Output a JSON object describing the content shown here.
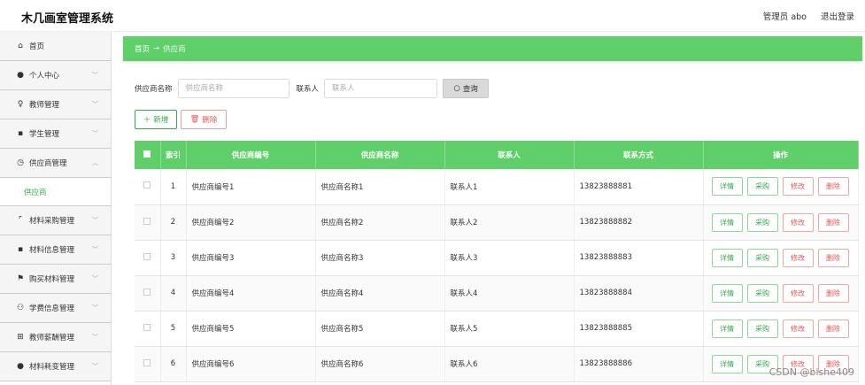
{
  "header": {
    "app_title": "木几画室管理系统",
    "admin_label": "管理员 abo",
    "logout": "退出登录"
  },
  "sidebar": {
    "items": [
      {
        "label": "首页",
        "icon": "home-icon",
        "glyph": "⌂"
      },
      {
        "label": "个人中心",
        "icon": "user-icon",
        "glyph": "●"
      },
      {
        "label": "教师管理",
        "icon": "teacher-icon",
        "glyph": "♀"
      },
      {
        "label": "学生管理",
        "icon": "student-icon",
        "glyph": "▪"
      },
      {
        "label": "供应商管理",
        "icon": "clock-icon",
        "glyph": "◷"
      },
      {
        "label": "供应商",
        "icon": "",
        "glyph": ""
      },
      {
        "label": "材料采购管理",
        "icon": "frame-icon",
        "glyph": "⌜"
      },
      {
        "label": "材料信息管理",
        "icon": "clipboard-icon",
        "glyph": "▪"
      },
      {
        "label": "购买材料管理",
        "icon": "flag-icon",
        "glyph": "⚑"
      },
      {
        "label": "学费信息管理",
        "icon": "chart-icon",
        "glyph": "⚇"
      },
      {
        "label": "教师薪酬管理",
        "icon": "grid-icon",
        "glyph": "⊞"
      },
      {
        "label": "材料耗变管理",
        "icon": "pin-icon",
        "glyph": "●"
      }
    ]
  },
  "breadcrumb": {
    "home": "首页",
    "arrow": "→",
    "current": "供应商"
  },
  "search": {
    "supplier_name_label": "供应商名称",
    "supplier_name_placeholder": "供应商名称",
    "contact_label": "联系人",
    "contact_placeholder": "联系人",
    "query_button": "查询"
  },
  "actions": {
    "add": "新增",
    "delete": "删除"
  },
  "table": {
    "headers": [
      "索引",
      "供应商编号",
      "供应商名称",
      "联系人",
      "联系方式",
      "操作"
    ],
    "op_labels": [
      "详情",
      "采购",
      "修改",
      "删除"
    ],
    "rows": [
      {
        "idx": "1",
        "code": "供应商编号1",
        "name": "供应商名称1",
        "contact": "联系人1",
        "phone": "13823888881"
      },
      {
        "idx": "2",
        "code": "供应商编号2",
        "name": "供应商名称2",
        "contact": "联系人2",
        "phone": "13823888882"
      },
      {
        "idx": "3",
        "code": "供应商编号3",
        "name": "供应商名称3",
        "contact": "联系人3",
        "phone": "13823888883"
      },
      {
        "idx": "4",
        "code": "供应商编号4",
        "name": "供应商名称4",
        "contact": "联系人4",
        "phone": "13823888884"
      },
      {
        "idx": "5",
        "code": "供应商编号5",
        "name": "供应商名称5",
        "contact": "联系人5",
        "phone": "13823888885"
      },
      {
        "idx": "6",
        "code": "供应商编号6",
        "name": "供应商名称6",
        "contact": "联系人6",
        "phone": "13823888886"
      }
    ]
  },
  "watermark": "CSDN @bishe409",
  "colors": {
    "accent": "#5fcf6a",
    "danger": "#e05a5a"
  }
}
